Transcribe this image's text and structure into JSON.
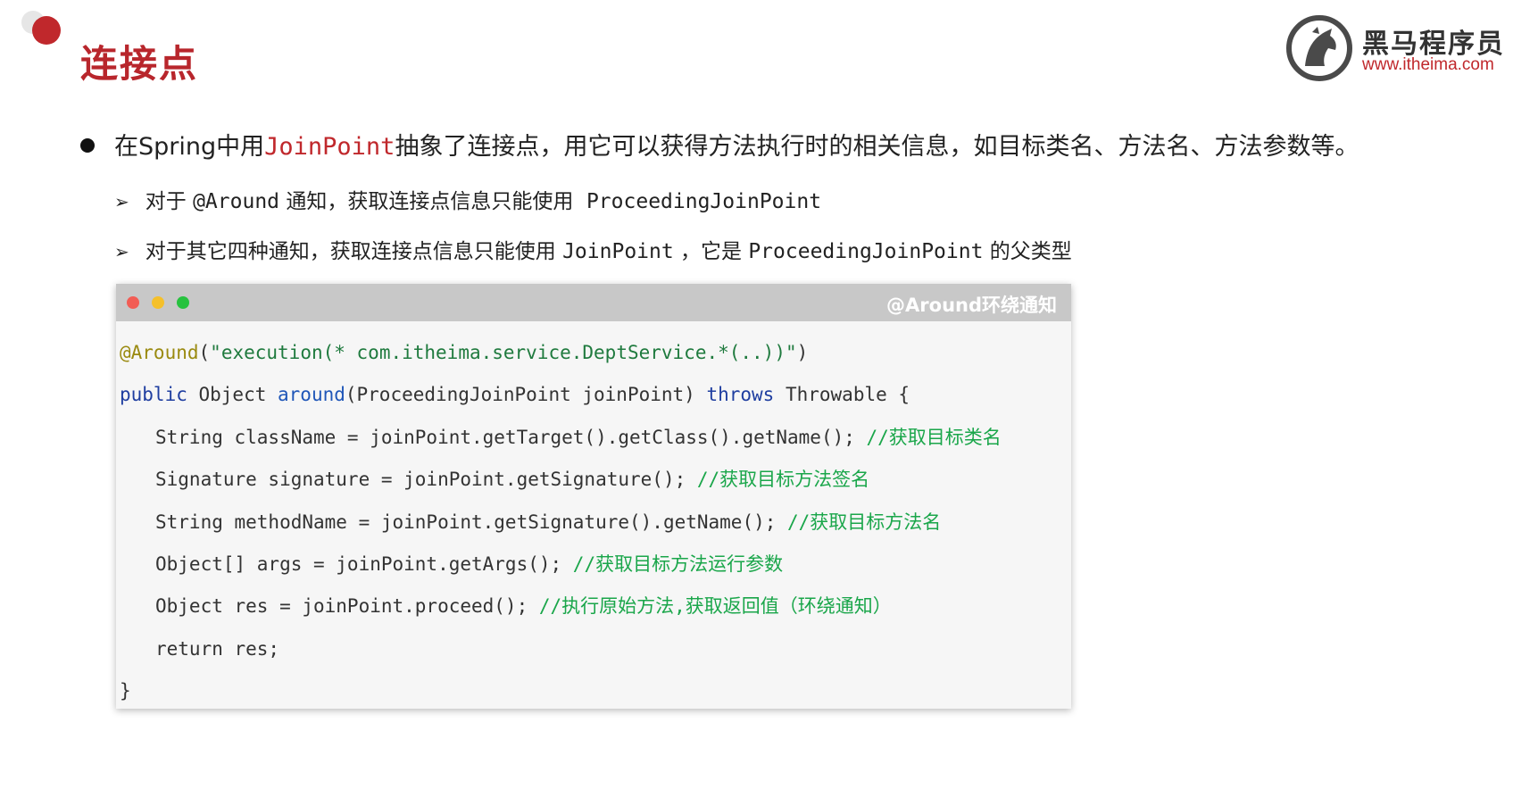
{
  "slide": {
    "title": "连接点"
  },
  "logo": {
    "icon": "horse-head-icon",
    "name": "黑马程序员",
    "url": "www.itheima.com",
    "accent": "#c0282c"
  },
  "main_bullet": {
    "before": "在Spring中用",
    "highlight": "JoinPoint",
    "after": "抽象了连接点，用它可以获得方法执行时的相关信息，如目标类名、方法名、方法参数等。"
  },
  "sub_points": [
    {
      "arrow": "➢",
      "text": "对于 ",
      "code1": "@Around",
      "middle": " 通知，获取连接点信息只能使用  ",
      "code2": "ProceedingJoinPoint"
    },
    {
      "arrow": "➢",
      "text": "对于其它四种通知，获取连接点信息只能使用 ",
      "code1": "JoinPoint",
      "middle": " ，它是 ",
      "code2": "ProceedingJoinPoint",
      "tail": " 的父类型"
    }
  ],
  "code_window": {
    "title": "@Around环绕通知",
    "lines": {
      "l1_annot": "@Around",
      "l1_open": "(",
      "l1_str": "\"execution(* com.itheima.service.DeptService.*(..))\"",
      "l1_close": ")",
      "l2_kw": "public",
      "l2_type": " Object ",
      "l2_fn": "around",
      "l2_params": "(ProceedingJoinPoint joinPoint) ",
      "l2_kw2": "throws",
      "l2_rest": " Throwable {",
      "l3_code": "String className = joinPoint.getTarget().getClass().getName(); ",
      "l3_cmt": "//获取目标类名",
      "l4_code": "Signature signature = joinPoint.getSignature(); ",
      "l4_cmt": "//获取目标方法签名",
      "l5_code": "String methodName = joinPoint.getSignature().getName(); ",
      "l5_cmt": "//获取目标方法名",
      "l6_code": "Object[] args = joinPoint.getArgs(); ",
      "l6_cmt": "//获取目标方法运行参数",
      "l7_code": "Object res = joinPoint.proceed(); ",
      "l7_cmt": "//执行原始方法,获取返回值（环绕通知）",
      "l8_code": "return res;",
      "l9_code": "}"
    }
  }
}
